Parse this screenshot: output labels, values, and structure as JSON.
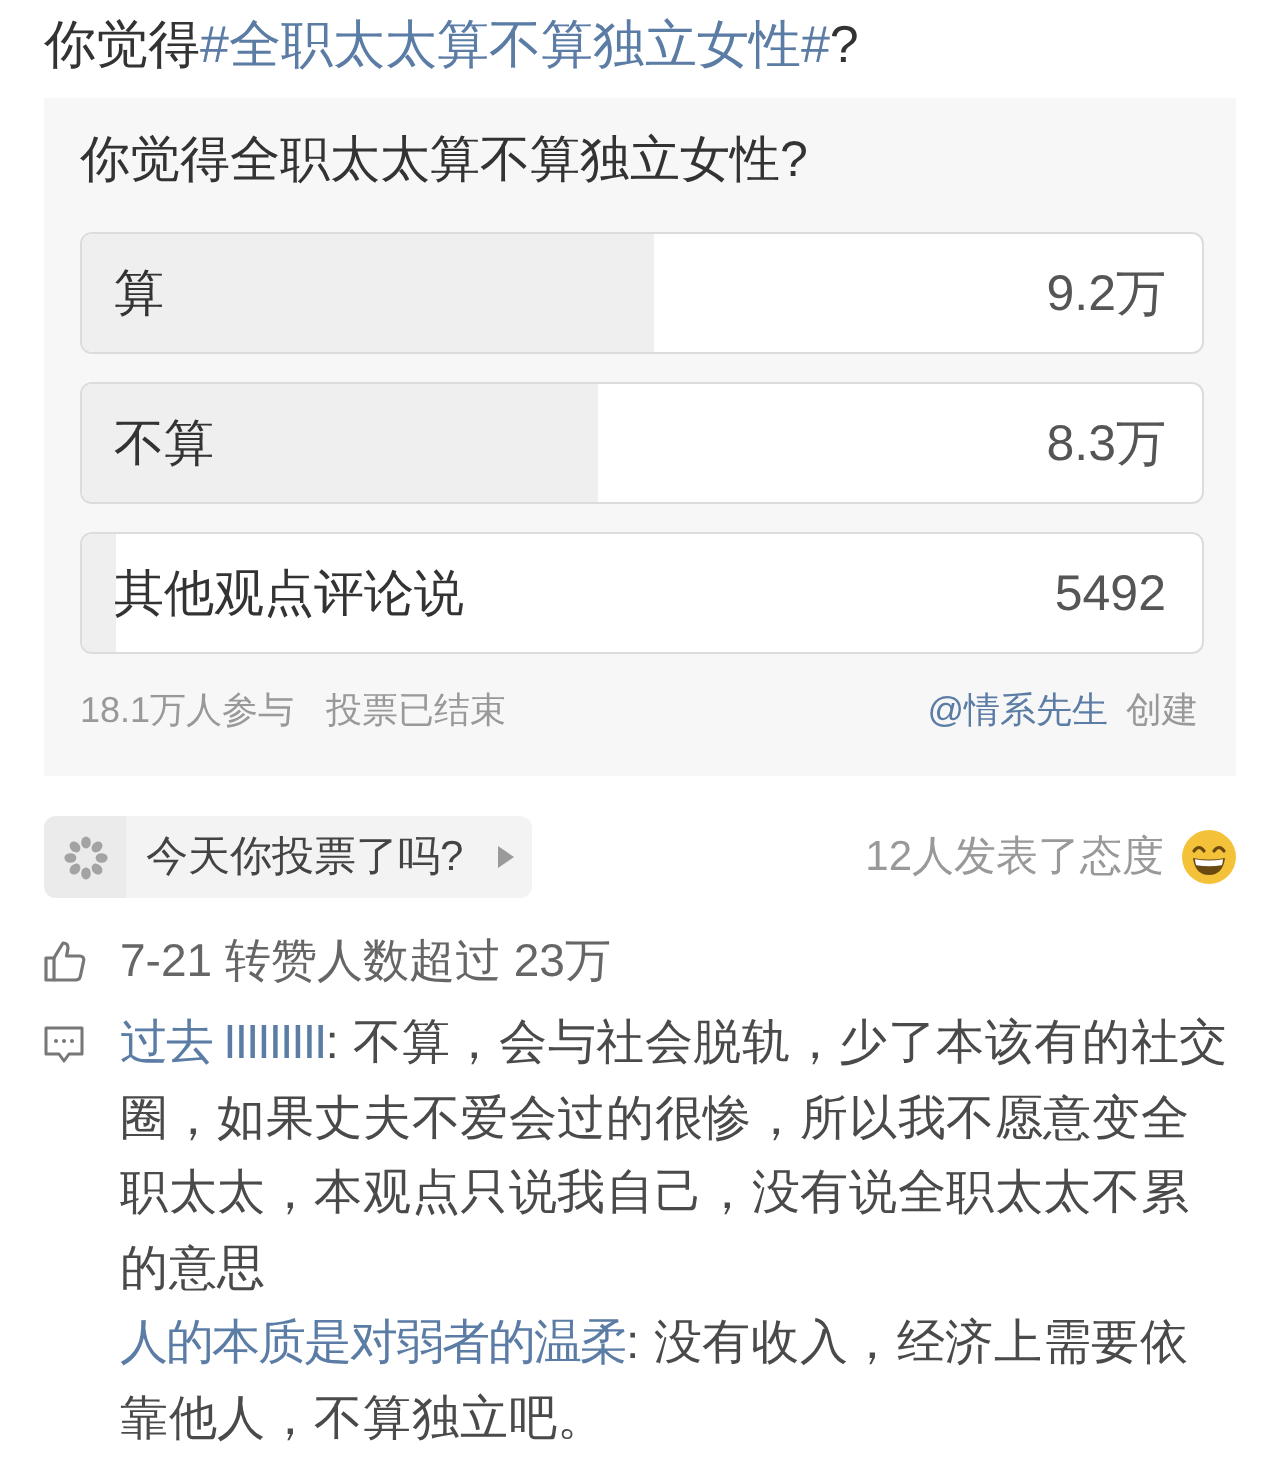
{
  "post_title": {
    "prefix": "你觉得",
    "hashtag": "#全职太太算不算独立女性#",
    "suffix": "?"
  },
  "poll": {
    "question": "你觉得全职太太算不算独立女性?",
    "options": [
      {
        "label": "算",
        "count": "9.2万",
        "level": 0.51
      },
      {
        "label": "不算",
        "count": "8.3万",
        "level": 0.46
      },
      {
        "label": "其他观点评论说",
        "count": "5492",
        "level": 0.03
      }
    ],
    "participants": "18.1万人参与",
    "status": "投票已结束",
    "creator": "@情系先生",
    "creator_action": "创建"
  },
  "vote_prompt": {
    "label": "今天你投票了吗?"
  },
  "attitudes": {
    "label": "12人发表了态度"
  },
  "repost_note": "7-21 转赞人数超过 23万",
  "comments": [
    {
      "author": "过去 IIIIIIIII",
      "text": ": 不算，会与社会脱轨，少了本该有的社交圈，如果丈夫不爱会过的很惨，所以我不愿意变全职太太，本观点只说我自己，没有说全职太太不累的意思"
    },
    {
      "author": "人的本质是对弱者的温柔",
      "text": ": 没有收入，经济上需要依靠他人，不算独立吧。"
    }
  ]
}
